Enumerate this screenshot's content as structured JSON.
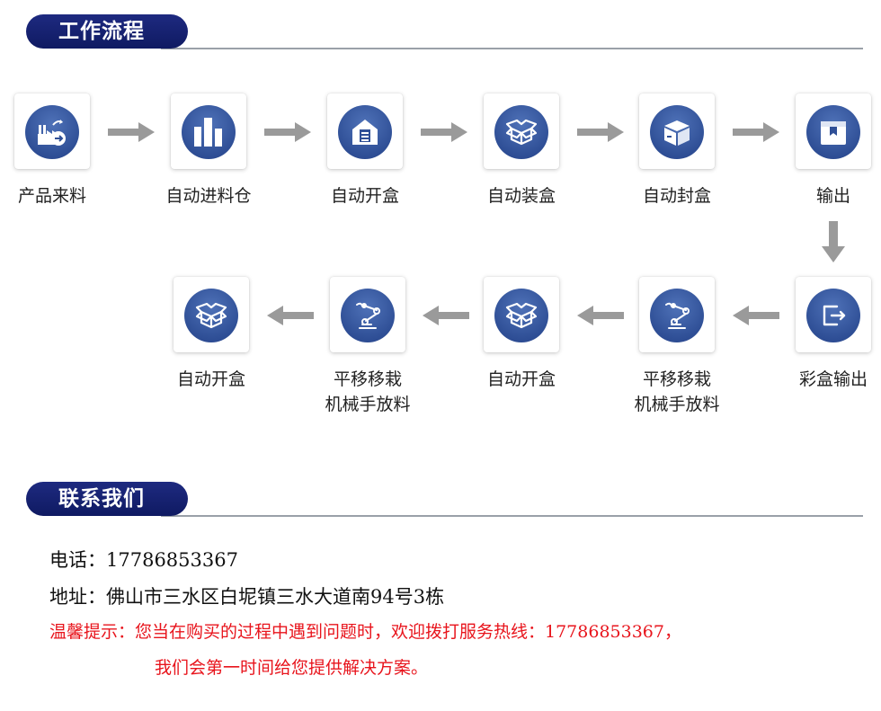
{
  "workflow": {
    "title": "工作流程",
    "steps": [
      {
        "label": "产品来料",
        "icon": "factory-arrow-icon"
      },
      {
        "label": "自动进料仓",
        "icon": "silo-icon"
      },
      {
        "label": "自动开盒",
        "icon": "warehouse-icon"
      },
      {
        "label": "自动装盒",
        "icon": "open-box-icon"
      },
      {
        "label": "自动封盒",
        "icon": "closed-box-icon"
      },
      {
        "label": "输出",
        "icon": "package-icon"
      },
      {
        "label": "彩盒输出",
        "icon": "exit-icon"
      },
      {
        "label": "平移移栽",
        "label2": "机械手放料",
        "icon": "robot-arm-icon"
      },
      {
        "label": "自动开盒",
        "icon": "open-box-icon"
      },
      {
        "label": "平移移栽",
        "label2": "机械手放料",
        "icon": "robot-arm-icon"
      },
      {
        "label": "自动开盒",
        "icon": "open-box-icon"
      }
    ]
  },
  "contact": {
    "title": "联系我们",
    "phone": "电话：17786853367",
    "address": "地址：佛山市三水区白坭镇三水大道南94号3栋",
    "tip_line1": "温馨提示：您当在购买的过程中遇到问题时，欢迎拨打服务热线：17786853367，",
    "tip_line2": "我们会第一时间给您提供解决方案。"
  },
  "colors": {
    "header": "#1a2472",
    "icon_circle": "#3a5ba6",
    "arrow": "#9a9a9a",
    "tip": "#e8141c"
  }
}
